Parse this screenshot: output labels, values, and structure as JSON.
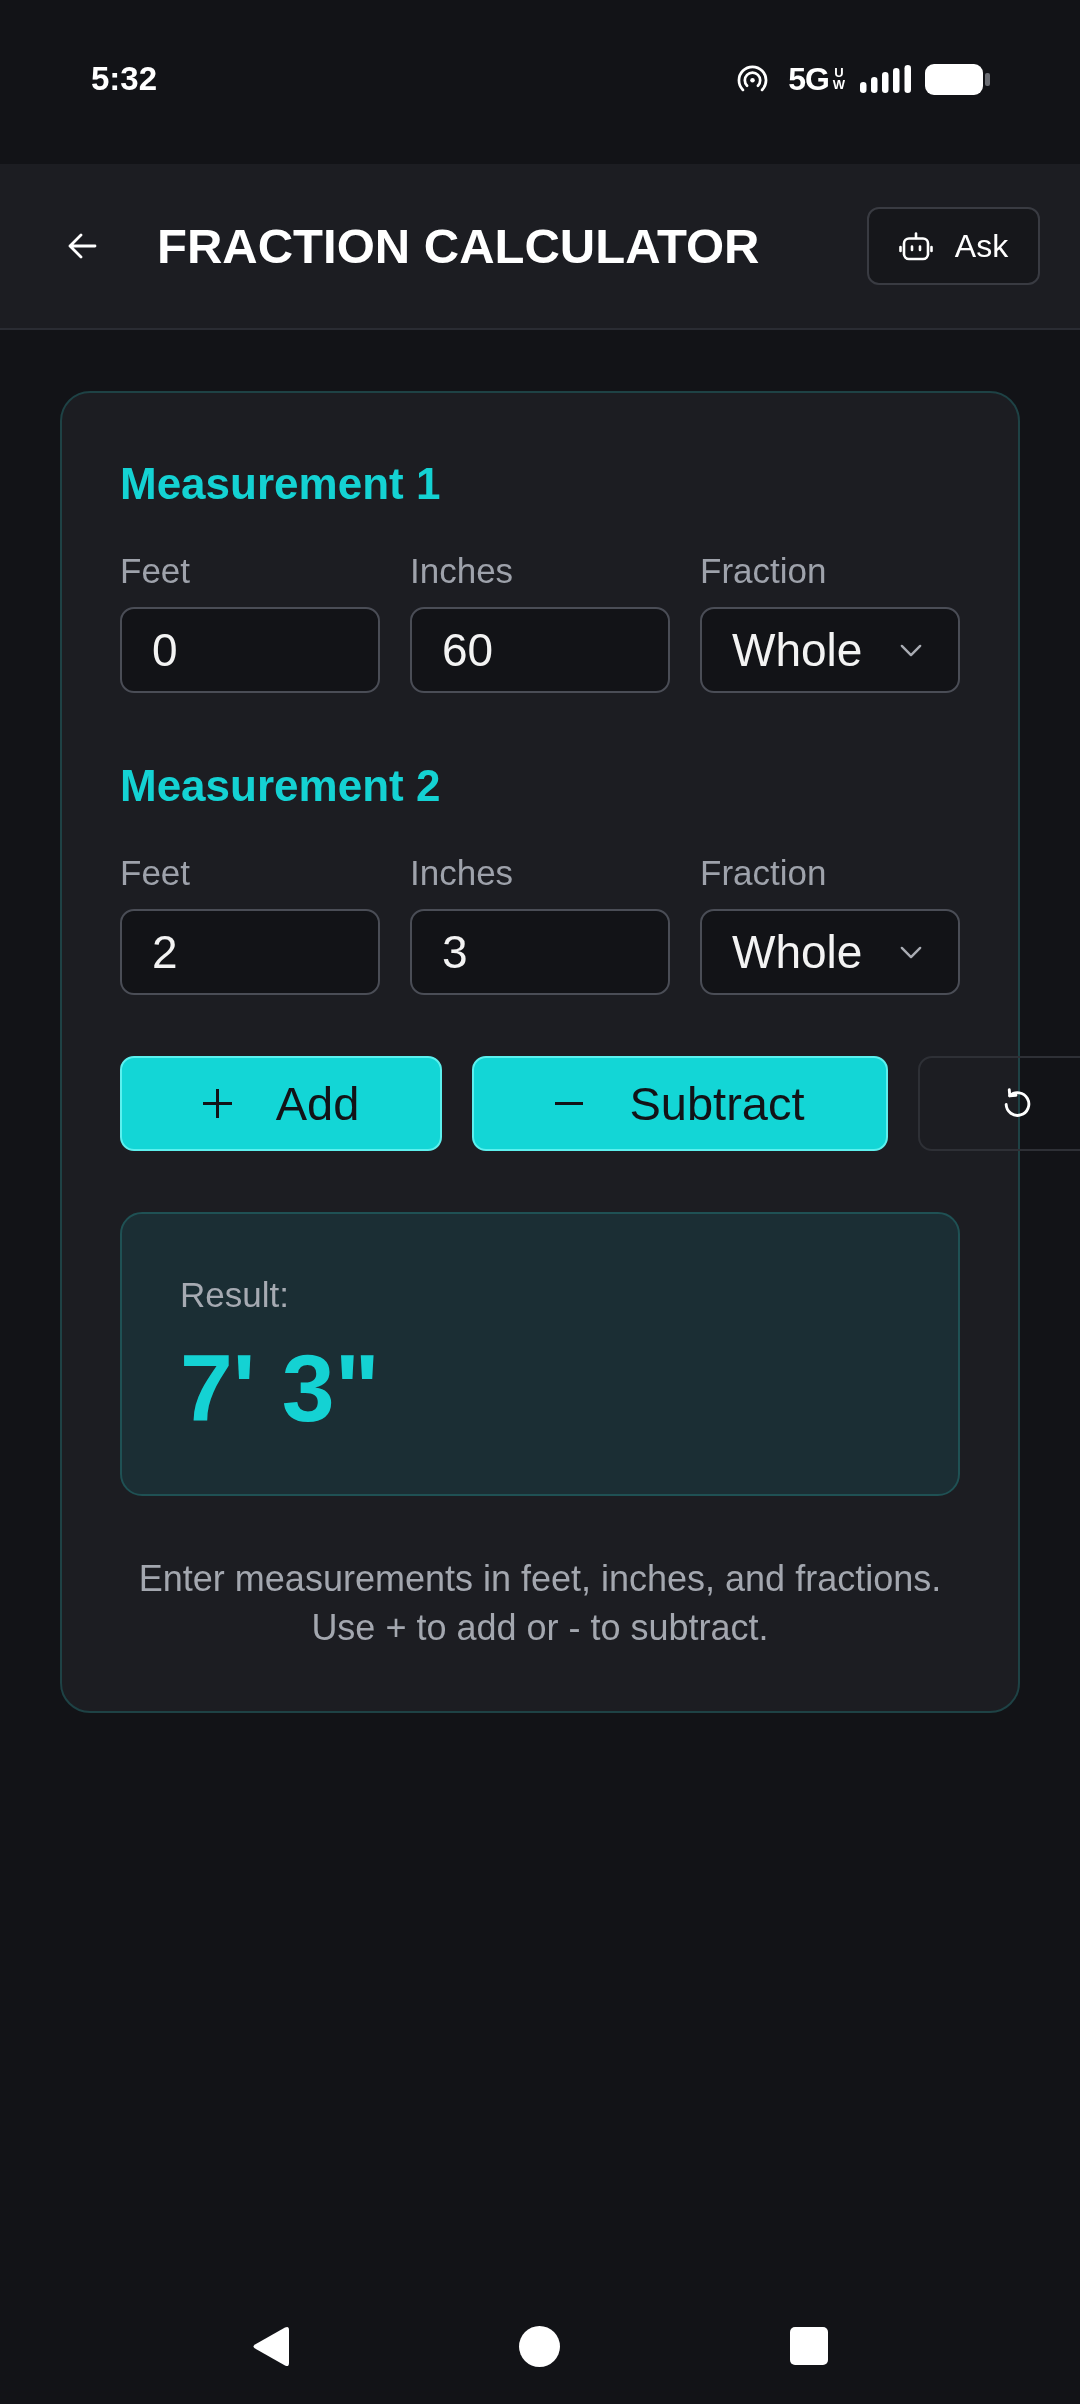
{
  "status_bar": {
    "time": "5:32",
    "network": "5G",
    "network_badge": "UW"
  },
  "app_bar": {
    "title": "FRACTION CALCULATOR",
    "ask_button": "Ask"
  },
  "measurements": [
    {
      "title": "Measurement 1",
      "fields": [
        {
          "kind": "input",
          "label": "Feet",
          "value": "0"
        },
        {
          "kind": "input",
          "label": "Inches",
          "value": "60"
        },
        {
          "kind": "select",
          "label": "Fraction",
          "value": "Whole"
        }
      ]
    },
    {
      "title": "Measurement 2",
      "fields": [
        {
          "kind": "input",
          "label": "Feet",
          "value": "2"
        },
        {
          "kind": "input",
          "label": "Inches",
          "value": "3"
        },
        {
          "kind": "select",
          "label": "Fraction",
          "value": "Whole"
        }
      ]
    }
  ],
  "actions": [
    {
      "kind": "add",
      "label": "Add"
    },
    {
      "kind": "subtract",
      "label": "Subtract"
    },
    {
      "kind": "reset"
    }
  ],
  "result": {
    "label": "Result:",
    "value": "7' 3\""
  },
  "help_text": "Enter measurements in feet, inches, and fractions. Use + to add or - to subtract."
}
